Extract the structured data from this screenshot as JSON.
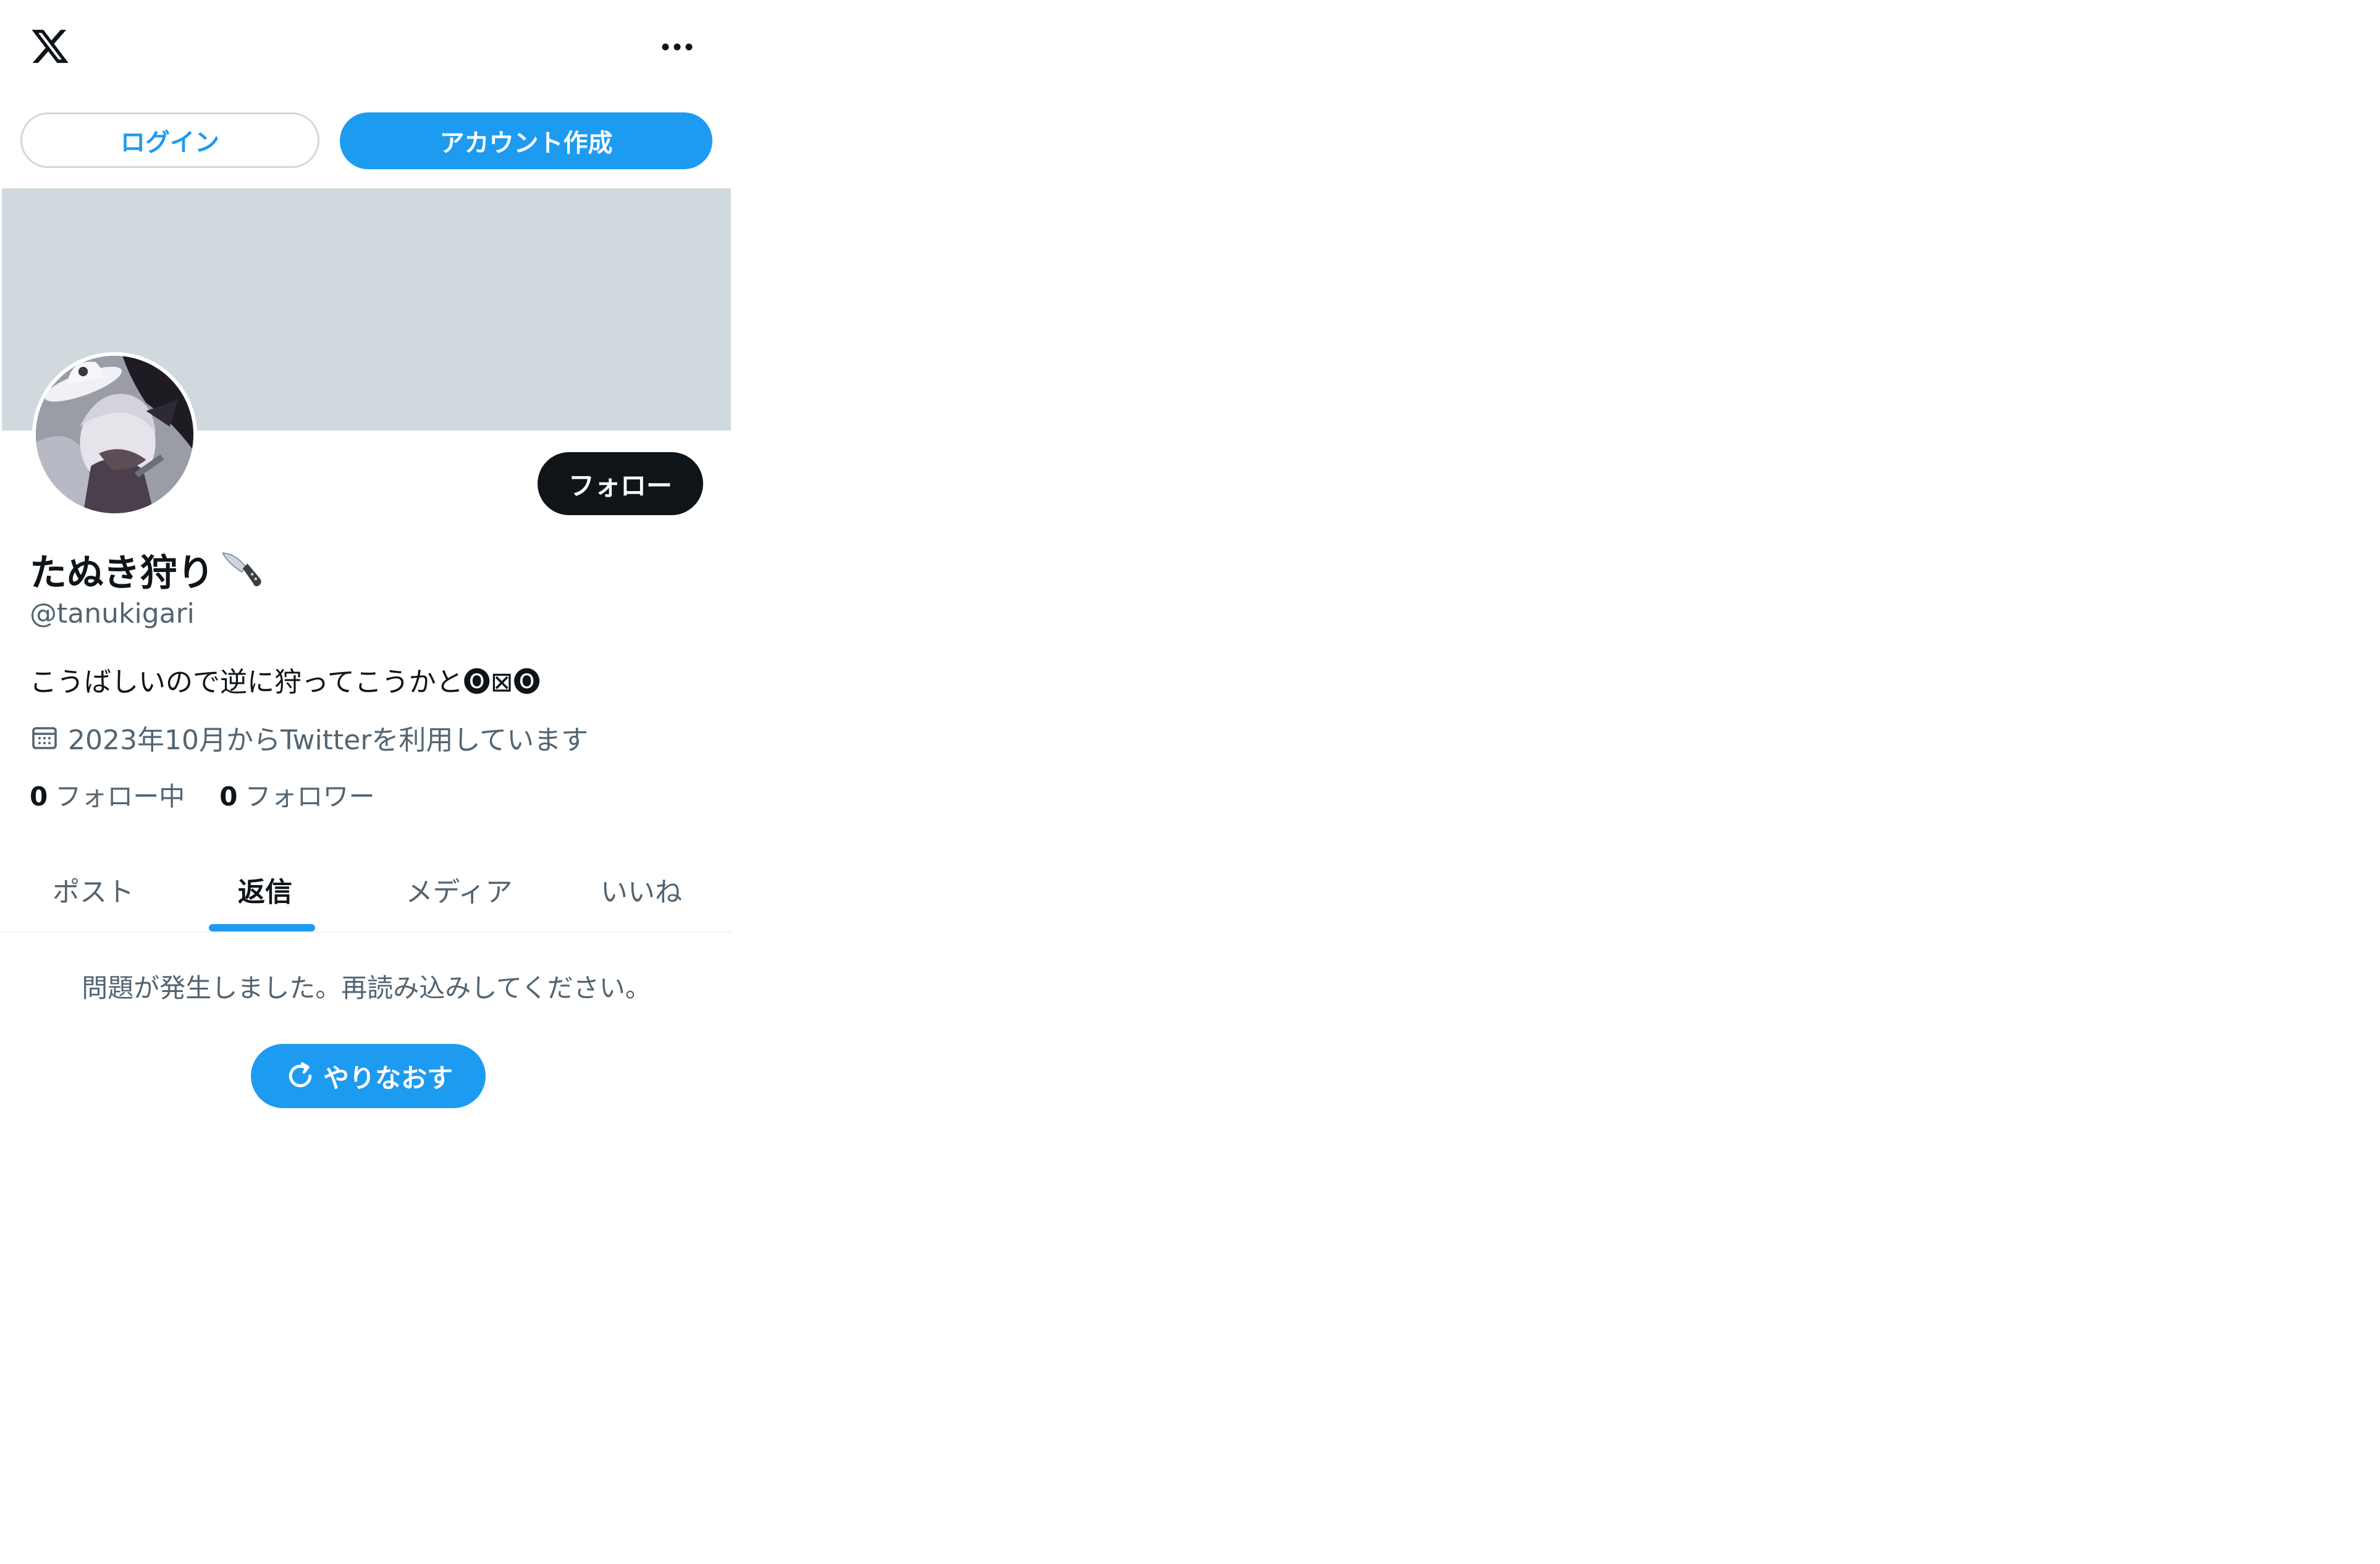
{
  "topbar": {
    "logo_icon": "x-logo-icon",
    "more_icon": "more-horizontal-icon"
  },
  "auth": {
    "login_label": "ログイン",
    "signup_label": "アカウント作成"
  },
  "profile": {
    "follow_label": "フォロー",
    "display_name": "たぬき狩り",
    "name_emoji": "knife-icon",
    "handle": "@tanukigari",
    "bio": "こうばしいので逆に狩ってこうかと🅞⊠🅞",
    "joined": "2023年10月からTwitterを利用しています",
    "following_count": "0",
    "following_label": "フォロー中",
    "followers_count": "0",
    "followers_label": "フォロワー"
  },
  "tabs": [
    {
      "label": "ポスト",
      "active": false
    },
    {
      "label": "返信",
      "active": true
    },
    {
      "label": "メディア",
      "active": false
    },
    {
      "label": "いいね",
      "active": false
    }
  ],
  "error": {
    "message": "問題が発生しました。再読み込みしてください。",
    "retry_label": "やりなおす"
  },
  "colors": {
    "accent": "#1d9bf0",
    "text_primary": "#0f1419",
    "text_secondary": "#536471",
    "banner": "#cfd9de",
    "follow_button": "#0f1419"
  }
}
